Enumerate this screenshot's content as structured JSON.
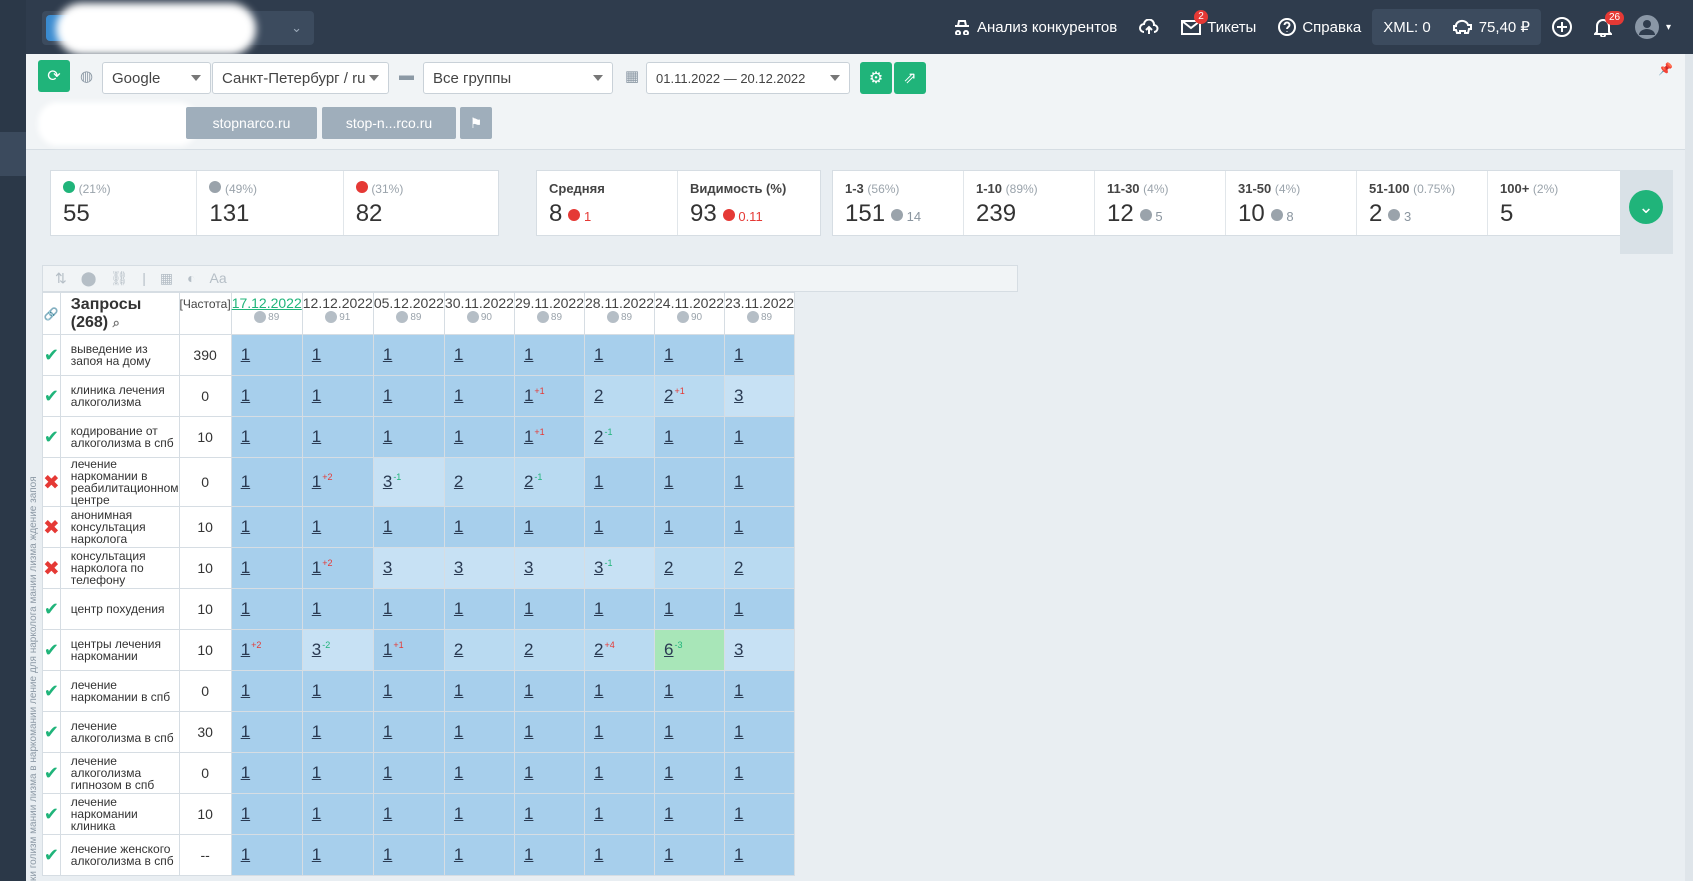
{
  "topbar": {
    "competitors_label": "Анализ конкурентов",
    "tickets_label": "Тикеты",
    "tickets_badge": "2",
    "help_label": "Справка",
    "xml_label": "XML: 0",
    "balance_label": "75,40 ₽",
    "notifications_badge": "26"
  },
  "toolbar": {
    "engine": "Google",
    "region": "Санкт-Петербург / ru",
    "group": "Все группы",
    "date_range": "01.11.2022 — 20.12.2022",
    "sites": [
      "stopnarco.ru",
      "stop-n...rco.ru"
    ]
  },
  "stats": {
    "up": {
      "pct": "(21%)",
      "value": "55"
    },
    "same": {
      "pct": "(49%)",
      "value": "131"
    },
    "down": {
      "pct": "(31%)",
      "value": "82"
    },
    "avg": {
      "label": "Средняя",
      "value": "8",
      "delta": "1"
    },
    "visibility": {
      "label": "Видимость (%)",
      "value": "93",
      "delta": "0.11"
    },
    "ranges": [
      {
        "label": "1-3",
        "pct": "(56%)",
        "value": "151",
        "delta": "14"
      },
      {
        "label": "1-10",
        "pct": "(89%)",
        "value": "239",
        "delta": ""
      },
      {
        "label": "11-30",
        "pct": "(4%)",
        "value": "12",
        "delta": "5"
      },
      {
        "label": "31-50",
        "pct": "(4%)",
        "value": "10",
        "delta": "8"
      },
      {
        "label": "51-100",
        "pct": "(0.75%)",
        "value": "2",
        "delta": "3"
      },
      {
        "label": "100+",
        "pct": "(2%)",
        "value": "5",
        "delta": ""
      }
    ]
  },
  "table": {
    "queries_header": "Запросы (268)",
    "freq_header": "[Частота]",
    "side_label": "ки голизм мании лизма в наркомании ление для нарколога мании лизма ждение запоя",
    "dates": [
      {
        "date": "17.12.2022",
        "vis": "89"
      },
      {
        "date": "12.12.2022",
        "vis": "91"
      },
      {
        "date": "05.12.2022",
        "vis": "89"
      },
      {
        "date": "30.11.2022",
        "vis": "90"
      },
      {
        "date": "29.11.2022",
        "vis": "89"
      },
      {
        "date": "28.11.2022",
        "vis": "89"
      },
      {
        "date": "24.11.2022",
        "vis": "90"
      },
      {
        "date": "23.11.2022",
        "vis": "89"
      }
    ],
    "rows": [
      {
        "status": "ok",
        "query": "выведение из запоя на дому",
        "freq": "390",
        "pos": [
          [
            "1",
            ""
          ],
          [
            "1",
            ""
          ],
          [
            "1",
            ""
          ],
          [
            "1",
            ""
          ],
          [
            "1",
            ""
          ],
          [
            "1",
            ""
          ],
          [
            "1",
            ""
          ],
          [
            "1",
            ""
          ]
        ]
      },
      {
        "status": "ok",
        "query": "клиника лечения алкоголизма",
        "freq": "0",
        "pos": [
          [
            "1",
            ""
          ],
          [
            "1",
            ""
          ],
          [
            "1",
            ""
          ],
          [
            "1",
            ""
          ],
          [
            "1",
            "+1"
          ],
          [
            "2",
            ""
          ],
          [
            "2",
            "+1"
          ],
          [
            "3",
            ""
          ]
        ]
      },
      {
        "status": "ok",
        "query": "кодирование от алкоголизма в спб",
        "freq": "10",
        "pos": [
          [
            "1",
            ""
          ],
          [
            "1",
            ""
          ],
          [
            "1",
            ""
          ],
          [
            "1",
            ""
          ],
          [
            "1",
            "+1"
          ],
          [
            "2",
            "-1"
          ],
          [
            "1",
            ""
          ],
          [
            "1",
            ""
          ]
        ]
      },
      {
        "status": "no",
        "query": "лечение наркомании в реабилитационном центре",
        "freq": "0",
        "pos": [
          [
            "1",
            ""
          ],
          [
            "1",
            "+2"
          ],
          [
            "3",
            "-1"
          ],
          [
            "2",
            ""
          ],
          [
            "2",
            "-1"
          ],
          [
            "1",
            ""
          ],
          [
            "1",
            ""
          ],
          [
            "1",
            ""
          ]
        ]
      },
      {
        "status": "no",
        "query": "анонимная консультация нарколога",
        "freq": "10",
        "pos": [
          [
            "1",
            ""
          ],
          [
            "1",
            ""
          ],
          [
            "1",
            ""
          ],
          [
            "1",
            ""
          ],
          [
            "1",
            ""
          ],
          [
            "1",
            ""
          ],
          [
            "1",
            ""
          ],
          [
            "1",
            ""
          ]
        ]
      },
      {
        "status": "no",
        "query": "консультация нарколога по телефону",
        "freq": "10",
        "pos": [
          [
            "1",
            ""
          ],
          [
            "1",
            "+2"
          ],
          [
            "3",
            ""
          ],
          [
            "3",
            ""
          ],
          [
            "3",
            ""
          ],
          [
            "3",
            "-1"
          ],
          [
            "2",
            ""
          ],
          [
            "2",
            ""
          ]
        ]
      },
      {
        "status": "ok",
        "query": "центр похудения",
        "freq": "10",
        "pos": [
          [
            "1",
            ""
          ],
          [
            "1",
            ""
          ],
          [
            "1",
            ""
          ],
          [
            "1",
            ""
          ],
          [
            "1",
            ""
          ],
          [
            "1",
            ""
          ],
          [
            "1",
            ""
          ],
          [
            "1",
            ""
          ]
        ]
      },
      {
        "status": "ok",
        "query": "центры лечения наркомании",
        "freq": "10",
        "pos": [
          [
            "1",
            "+2"
          ],
          [
            "3",
            "-2"
          ],
          [
            "1",
            "+1"
          ],
          [
            "2",
            ""
          ],
          [
            "2",
            ""
          ],
          [
            "2",
            "+4"
          ],
          [
            "6",
            "-3"
          ],
          [
            "3",
            ""
          ]
        ]
      },
      {
        "status": "ok",
        "query": "лечение наркомании в спб",
        "freq": "0",
        "pos": [
          [
            "1",
            ""
          ],
          [
            "1",
            ""
          ],
          [
            "1",
            ""
          ],
          [
            "1",
            ""
          ],
          [
            "1",
            ""
          ],
          [
            "1",
            ""
          ],
          [
            "1",
            ""
          ],
          [
            "1",
            ""
          ]
        ]
      },
      {
        "status": "ok",
        "query": "лечение алкоголизма в спб",
        "freq": "30",
        "pos": [
          [
            "1",
            ""
          ],
          [
            "1",
            ""
          ],
          [
            "1",
            ""
          ],
          [
            "1",
            ""
          ],
          [
            "1",
            ""
          ],
          [
            "1",
            ""
          ],
          [
            "1",
            ""
          ],
          [
            "1",
            ""
          ]
        ]
      },
      {
        "status": "ok",
        "query": "лечение алкоголизма гипнозом в спб",
        "freq": "0",
        "pos": [
          [
            "1",
            ""
          ],
          [
            "1",
            ""
          ],
          [
            "1",
            ""
          ],
          [
            "1",
            ""
          ],
          [
            "1",
            ""
          ],
          [
            "1",
            ""
          ],
          [
            "1",
            ""
          ],
          [
            "1",
            ""
          ]
        ]
      },
      {
        "status": "ok",
        "query": "лечение наркомании клиника",
        "freq": "10",
        "pos": [
          [
            "1",
            ""
          ],
          [
            "1",
            ""
          ],
          [
            "1",
            ""
          ],
          [
            "1",
            ""
          ],
          [
            "1",
            ""
          ],
          [
            "1",
            ""
          ],
          [
            "1",
            ""
          ],
          [
            "1",
            ""
          ]
        ]
      },
      {
        "status": "ok",
        "query": "лечение женского алкоголизма в спб",
        "freq": "--",
        "pos": [
          [
            "1",
            ""
          ],
          [
            "1",
            ""
          ],
          [
            "1",
            ""
          ],
          [
            "1",
            ""
          ],
          [
            "1",
            ""
          ],
          [
            "1",
            ""
          ],
          [
            "1",
            ""
          ],
          [
            "1",
            ""
          ]
        ]
      }
    ]
  }
}
